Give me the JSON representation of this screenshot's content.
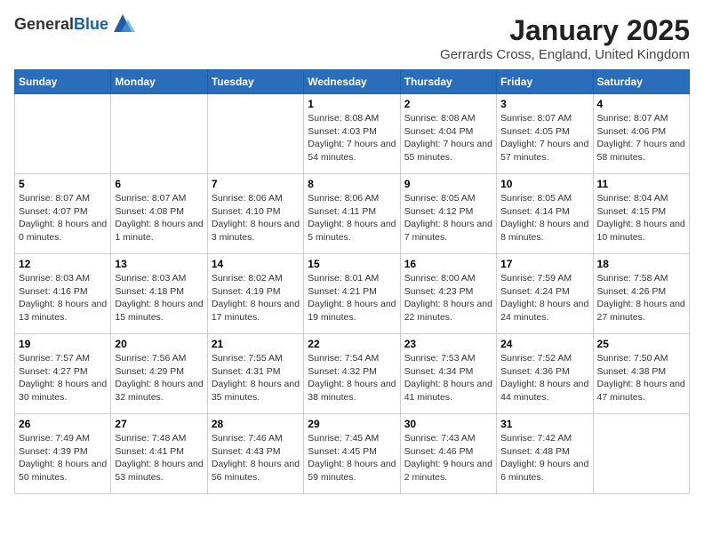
{
  "header": {
    "logo_general": "General",
    "logo_blue": "Blue",
    "month_title": "January 2025",
    "location": "Gerrards Cross, England, United Kingdom"
  },
  "days_of_week": [
    "Sunday",
    "Monday",
    "Tuesday",
    "Wednesday",
    "Thursday",
    "Friday",
    "Saturday"
  ],
  "weeks": [
    [
      {
        "day": "",
        "info": ""
      },
      {
        "day": "",
        "info": ""
      },
      {
        "day": "",
        "info": ""
      },
      {
        "day": "1",
        "info": "Sunrise: 8:08 AM\nSunset: 4:03 PM\nDaylight: 7 hours and 54 minutes."
      },
      {
        "day": "2",
        "info": "Sunrise: 8:08 AM\nSunset: 4:04 PM\nDaylight: 7 hours and 55 minutes."
      },
      {
        "day": "3",
        "info": "Sunrise: 8:07 AM\nSunset: 4:05 PM\nDaylight: 7 hours and 57 minutes."
      },
      {
        "day": "4",
        "info": "Sunrise: 8:07 AM\nSunset: 4:06 PM\nDaylight: 7 hours and 58 minutes."
      }
    ],
    [
      {
        "day": "5",
        "info": "Sunrise: 8:07 AM\nSunset: 4:07 PM\nDaylight: 8 hours and 0 minutes."
      },
      {
        "day": "6",
        "info": "Sunrise: 8:07 AM\nSunset: 4:08 PM\nDaylight: 8 hours and 1 minute."
      },
      {
        "day": "7",
        "info": "Sunrise: 8:06 AM\nSunset: 4:10 PM\nDaylight: 8 hours and 3 minutes."
      },
      {
        "day": "8",
        "info": "Sunrise: 8:06 AM\nSunset: 4:11 PM\nDaylight: 8 hours and 5 minutes."
      },
      {
        "day": "9",
        "info": "Sunrise: 8:05 AM\nSunset: 4:12 PM\nDaylight: 8 hours and 7 minutes."
      },
      {
        "day": "10",
        "info": "Sunrise: 8:05 AM\nSunset: 4:14 PM\nDaylight: 8 hours and 8 minutes."
      },
      {
        "day": "11",
        "info": "Sunrise: 8:04 AM\nSunset: 4:15 PM\nDaylight: 8 hours and 10 minutes."
      }
    ],
    [
      {
        "day": "12",
        "info": "Sunrise: 8:03 AM\nSunset: 4:16 PM\nDaylight: 8 hours and 13 minutes."
      },
      {
        "day": "13",
        "info": "Sunrise: 8:03 AM\nSunset: 4:18 PM\nDaylight: 8 hours and 15 minutes."
      },
      {
        "day": "14",
        "info": "Sunrise: 8:02 AM\nSunset: 4:19 PM\nDaylight: 8 hours and 17 minutes."
      },
      {
        "day": "15",
        "info": "Sunrise: 8:01 AM\nSunset: 4:21 PM\nDaylight: 8 hours and 19 minutes."
      },
      {
        "day": "16",
        "info": "Sunrise: 8:00 AM\nSunset: 4:23 PM\nDaylight: 8 hours and 22 minutes."
      },
      {
        "day": "17",
        "info": "Sunrise: 7:59 AM\nSunset: 4:24 PM\nDaylight: 8 hours and 24 minutes."
      },
      {
        "day": "18",
        "info": "Sunrise: 7:58 AM\nSunset: 4:26 PM\nDaylight: 8 hours and 27 minutes."
      }
    ],
    [
      {
        "day": "19",
        "info": "Sunrise: 7:57 AM\nSunset: 4:27 PM\nDaylight: 8 hours and 30 minutes."
      },
      {
        "day": "20",
        "info": "Sunrise: 7:56 AM\nSunset: 4:29 PM\nDaylight: 8 hours and 32 minutes."
      },
      {
        "day": "21",
        "info": "Sunrise: 7:55 AM\nSunset: 4:31 PM\nDaylight: 8 hours and 35 minutes."
      },
      {
        "day": "22",
        "info": "Sunrise: 7:54 AM\nSunset: 4:32 PM\nDaylight: 8 hours and 38 minutes."
      },
      {
        "day": "23",
        "info": "Sunrise: 7:53 AM\nSunset: 4:34 PM\nDaylight: 8 hours and 41 minutes."
      },
      {
        "day": "24",
        "info": "Sunrise: 7:52 AM\nSunset: 4:36 PM\nDaylight: 8 hours and 44 minutes."
      },
      {
        "day": "25",
        "info": "Sunrise: 7:50 AM\nSunset: 4:38 PM\nDaylight: 8 hours and 47 minutes."
      }
    ],
    [
      {
        "day": "26",
        "info": "Sunrise: 7:49 AM\nSunset: 4:39 PM\nDaylight: 8 hours and 50 minutes."
      },
      {
        "day": "27",
        "info": "Sunrise: 7:48 AM\nSunset: 4:41 PM\nDaylight: 8 hours and 53 minutes."
      },
      {
        "day": "28",
        "info": "Sunrise: 7:46 AM\nSunset: 4:43 PM\nDaylight: 8 hours and 56 minutes."
      },
      {
        "day": "29",
        "info": "Sunrise: 7:45 AM\nSunset: 4:45 PM\nDaylight: 8 hours and 59 minutes."
      },
      {
        "day": "30",
        "info": "Sunrise: 7:43 AM\nSunset: 4:46 PM\nDaylight: 9 hours and 2 minutes."
      },
      {
        "day": "31",
        "info": "Sunrise: 7:42 AM\nSunset: 4:48 PM\nDaylight: 9 hours and 6 minutes."
      },
      {
        "day": "",
        "info": ""
      }
    ]
  ]
}
